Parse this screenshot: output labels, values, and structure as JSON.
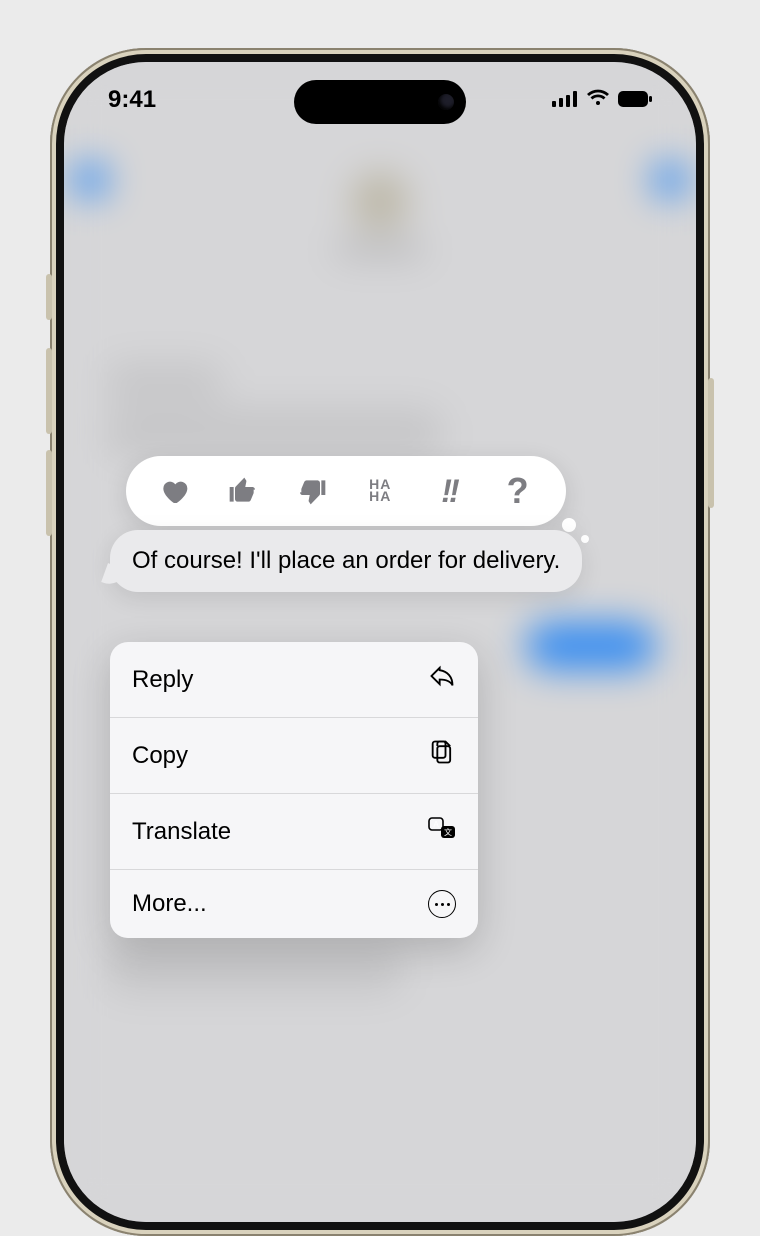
{
  "statusbar": {
    "time": "9:41"
  },
  "message": {
    "text": "Of course! I'll place an order for delivery."
  },
  "tapbacks": {
    "heart": "heart",
    "thumbs_up": "thumbs-up",
    "thumbs_down": "thumbs-down",
    "haha_line1": "HA",
    "haha_line2": "HA",
    "exclaim": "!!",
    "question": "?"
  },
  "menu": {
    "reply": "Reply",
    "copy": "Copy",
    "translate": "Translate",
    "more": "More..."
  }
}
